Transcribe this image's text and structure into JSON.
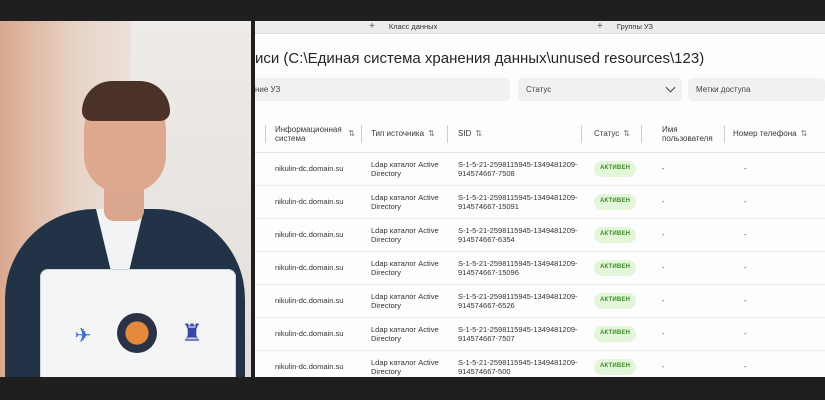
{
  "top_tabs": [
    {
      "label": "Класс данных"
    },
    {
      "label": "Группы УЗ"
    }
  ],
  "page_title": "иси (C:\\Единая система хранения данных\\unused resources\\123)",
  "filters": {
    "accounts_label": "ние УЗ",
    "status_label": "Статус",
    "access_labels_label": "Метки доступа"
  },
  "table": {
    "headers": {
      "info_system": "Информационная система",
      "source_type": "Тип источника",
      "sid": "SID",
      "status": "Статус",
      "username": "Имя пользователя",
      "phone": "Номер телефона"
    },
    "rows": [
      {
        "system": "nikulin-dc.domain.su",
        "source": "Ldap каталог Active Directory",
        "sid": "S-1-5-21-2598115945-1349481209-914574667-7508",
        "status": "АКТИВЕН",
        "user": "-",
        "phone": "-"
      },
      {
        "system": "nikulin-dc.domain.su",
        "source": "Ldap каталог Active Directory",
        "sid": "S-1-5-21-2598115945-1349481209-914574667-15091",
        "status": "АКТИВЕН",
        "user": "-",
        "phone": "-"
      },
      {
        "system": "nikulin-dc.domain.su",
        "source": "Ldap каталог Active Directory",
        "sid": "S-1-5-21-2598115945-1349481209-914574667-6354",
        "status": "АКТИВЕН",
        "user": "-",
        "phone": "-"
      },
      {
        "system": "nikulin-dc.domain.su",
        "source": "Ldap каталог Active Directory",
        "sid": "S-1-5-21-2598115945-1349481209-914574667-15096",
        "status": "АКТИВЕН",
        "user": "-",
        "phone": "-"
      },
      {
        "system": "nikulin-dc.domain.su",
        "source": "Ldap каталог Active Directory",
        "sid": "S-1-5-21-2598115945-1349481209-914574667-6526",
        "status": "АКТИВЕН",
        "user": "-",
        "phone": "-"
      },
      {
        "system": "nikulin-dc.domain.su",
        "source": "Ldap каталог Active Directory",
        "sid": "S-1-5-21-2598115945-1349481209-914574667-7507",
        "status": "АКТИВЕН",
        "user": "-",
        "phone": "-"
      },
      {
        "system": "nikulin-dc.domain.su",
        "source": "Ldap каталог Active Directory",
        "sid": "S-1-5-21-2598115945-1349481209-914574667-500",
        "status": "АКТИВЕН",
        "user": "-",
        "phone": "-"
      }
    ]
  },
  "colors": {
    "badge_bg": "#e3f6d9",
    "badge_text": "#3d8a2a"
  }
}
